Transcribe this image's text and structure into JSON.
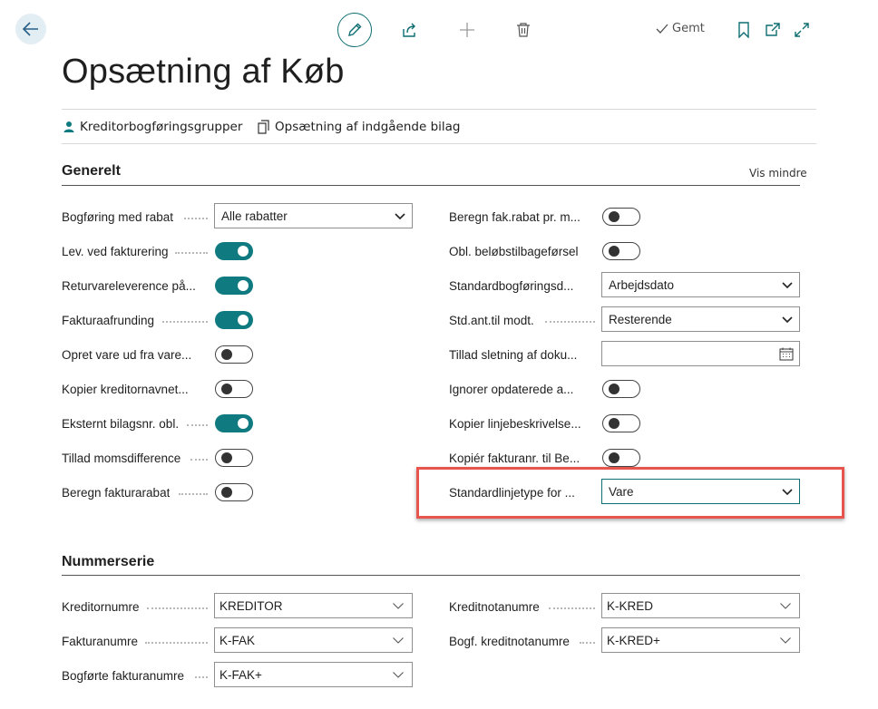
{
  "toolbar": {
    "saved_label": "Gemt"
  },
  "page": {
    "title": "Opsætning af Køb"
  },
  "actions": [
    {
      "label": "Kreditorbogføringsgrupper",
      "icon": "person-icon"
    },
    {
      "label": "Opsætning af indgående bilag",
      "icon": "document-icon"
    }
  ],
  "general": {
    "title": "Generelt",
    "show_less": "Vis mindre",
    "left": [
      {
        "label": "Bogføring med rabat",
        "type": "select",
        "value": "Alle rabatter"
      },
      {
        "label": "Lev. ved fakturering",
        "type": "toggle",
        "on": true
      },
      {
        "label": "Returvareleverence på...",
        "type": "toggle",
        "on": true
      },
      {
        "label": "Fakturaafrunding",
        "type": "toggle",
        "on": true
      },
      {
        "label": "Opret vare ud fra vare...",
        "type": "toggle",
        "on": false
      },
      {
        "label": "Kopier kreditornavnet...",
        "type": "toggle",
        "on": false
      },
      {
        "label": "Eksternt bilagsnr. obl.",
        "type": "toggle",
        "on": true
      },
      {
        "label": "Tillad momsdifference",
        "type": "toggle",
        "on": false
      },
      {
        "label": "Beregn fakturarabat",
        "type": "toggle",
        "on": false
      }
    ],
    "right": [
      {
        "label": "Beregn fak.rabat pr. m...",
        "type": "toggle",
        "on": false
      },
      {
        "label": "Obl. beløbstilbageførsel",
        "type": "toggle",
        "on": false
      },
      {
        "label": "Standardbogføringsd...",
        "type": "select",
        "value": "Arbejdsdato"
      },
      {
        "label": "Std.ant.til modt.",
        "type": "select",
        "value": "Resterende"
      },
      {
        "label": "Tillad sletning af doku...",
        "type": "date",
        "value": ""
      },
      {
        "label": "Ignorer opdaterede a...",
        "type": "toggle",
        "on": false
      },
      {
        "label": "Kopier linjebeskrivelse...",
        "type": "toggle",
        "on": false
      },
      {
        "label": "Kopiér fakturanr. til Be...",
        "type": "toggle",
        "on": false
      },
      {
        "label": "Standardlinjetype for ...",
        "type": "select",
        "value": "Vare"
      }
    ]
  },
  "number_series": {
    "title": "Nummerserie",
    "left": [
      {
        "label": "Kreditornumre",
        "value": "KREDITOR"
      },
      {
        "label": "Fakturanumre",
        "value": "K-FAK"
      },
      {
        "label": "Bogførte fakturanumre",
        "value": "K-FAK+"
      }
    ],
    "right": [
      {
        "label": "Kreditnotanumre",
        "value": "K-KRED"
      },
      {
        "label": "Bogf. kreditnotanumre",
        "value": "K-KRED+"
      }
    ]
  },
  "colors": {
    "accent": "#0f7b80",
    "highlight": "#e8554e"
  }
}
